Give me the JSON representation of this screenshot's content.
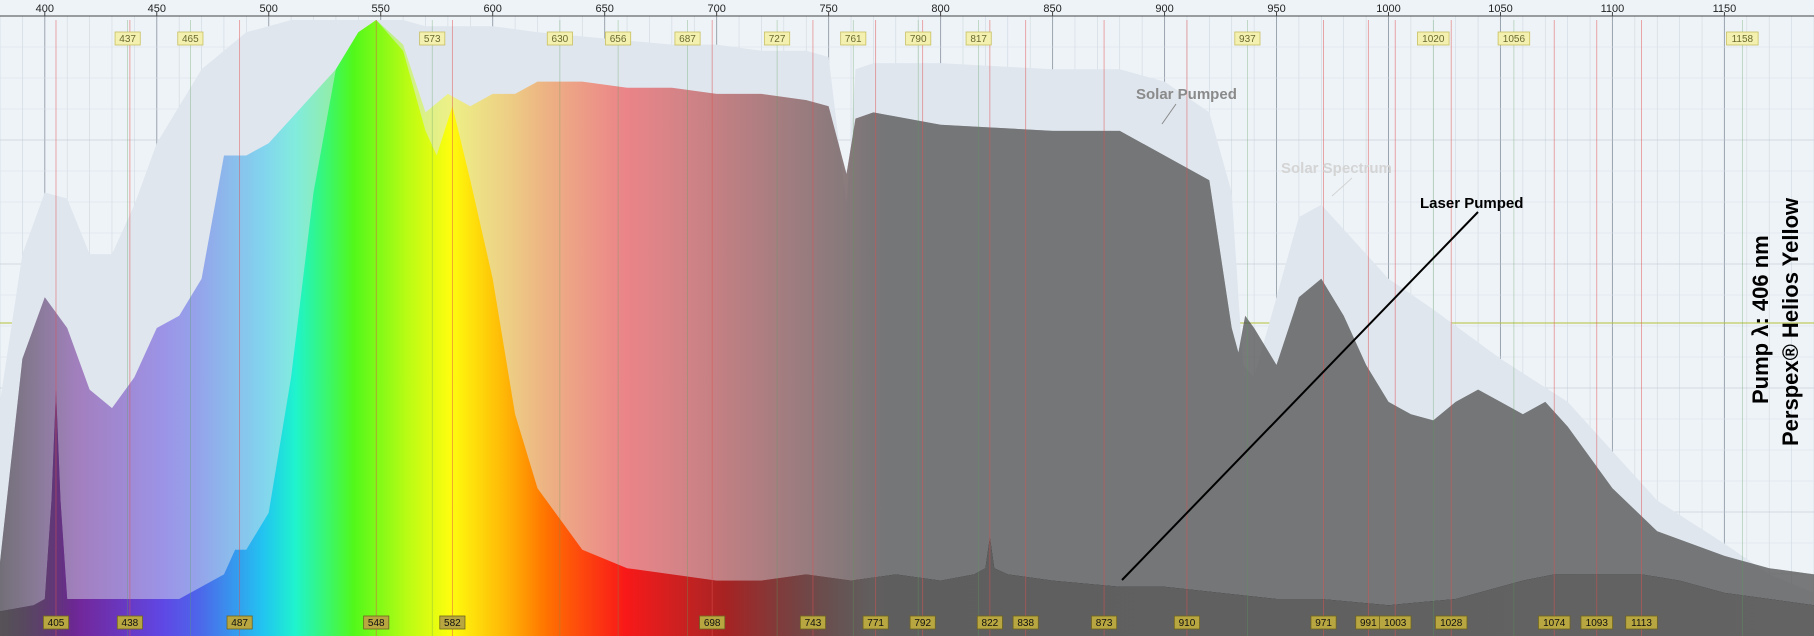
{
  "chart_data": {
    "type": "area",
    "xlim": [
      380,
      1190
    ],
    "x_ticks": [
      "400",
      "450",
      "500",
      "550",
      "600",
      "650",
      "700",
      "750",
      "800",
      "850",
      "900",
      "950",
      "1000",
      "1050",
      "1100",
      "1150"
    ],
    "top_peak_labels": [
      "437",
      "465",
      "573",
      "630",
      "656",
      "687",
      "727",
      "761",
      "790",
      "817",
      "937",
      "1020",
      "1056",
      "1158"
    ],
    "bottom_peak_labels": [
      "405",
      "438",
      "487",
      "548",
      "582",
      "698",
      "743",
      "771",
      "792",
      "822",
      "838",
      "873",
      "910",
      "971",
      "991",
      "1003",
      "1028",
      "1074",
      "1093",
      "1113"
    ],
    "annotations": {
      "solar_pumped": "Solar Pumped",
      "solar_spectrum": "Solar Spectrum",
      "laser_pumped": "Laser Pumped",
      "material": "Perspex® Helios Yellow",
      "pump": "Pump λ: 406 nm"
    },
    "series": [
      {
        "name": "Solar Spectrum",
        "x": [
          380,
          390,
          400,
          410,
          420,
          430,
          440,
          450,
          460,
          470,
          480,
          490,
          500,
          510,
          520,
          530,
          540,
          550,
          560,
          570,
          580,
          590,
          600,
          620,
          650,
          680,
          700,
          720,
          740,
          750,
          758,
          762,
          770,
          800,
          850,
          880,
          900,
          920,
          930,
          935,
          940,
          950,
          960,
          970,
          980,
          1000,
          1020,
          1050,
          1080,
          1100,
          1120,
          1150,
          1170,
          1190
        ],
        "y": [
          0.38,
          0.62,
          0.72,
          0.71,
          0.62,
          0.62,
          0.7,
          0.8,
          0.86,
          0.92,
          0.95,
          0.98,
          0.99,
          1.0,
          1.0,
          1.0,
          1.0,
          1.0,
          1.0,
          0.99,
          0.99,
          0.99,
          0.99,
          0.98,
          0.97,
          0.96,
          0.96,
          0.95,
          0.95,
          0.94,
          0.7,
          0.92,
          0.93,
          0.93,
          0.92,
          0.92,
          0.9,
          0.85,
          0.72,
          0.44,
          0.42,
          0.55,
          0.68,
          0.7,
          0.66,
          0.58,
          0.53,
          0.45,
          0.38,
          0.3,
          0.22,
          0.15,
          0.1,
          0.07
        ]
      },
      {
        "name": "Solar Pumped",
        "x": [
          380,
          390,
          400,
          410,
          420,
          430,
          440,
          450,
          460,
          470,
          480,
          490,
          500,
          510,
          520,
          530,
          540,
          548,
          560,
          570,
          580,
          590,
          600,
          610,
          620,
          640,
          660,
          680,
          700,
          720,
          740,
          750,
          758,
          762,
          770,
          800,
          850,
          880,
          900,
          920,
          930,
          933,
          936,
          940,
          950,
          960,
          970,
          980,
          990,
          1000,
          1010,
          1020,
          1030,
          1040,
          1050,
          1060,
          1070,
          1080,
          1100,
          1120,
          1150,
          1170,
          1190
        ],
        "y": [
          0.12,
          0.45,
          0.55,
          0.5,
          0.4,
          0.37,
          0.42,
          0.5,
          0.52,
          0.58,
          0.78,
          0.78,
          0.8,
          0.84,
          0.88,
          0.92,
          0.96,
          1.0,
          0.96,
          0.85,
          0.88,
          0.86,
          0.88,
          0.88,
          0.9,
          0.9,
          0.89,
          0.89,
          0.88,
          0.88,
          0.87,
          0.86,
          0.75,
          0.84,
          0.85,
          0.83,
          0.82,
          0.82,
          0.78,
          0.74,
          0.5,
          0.46,
          0.52,
          0.5,
          0.44,
          0.55,
          0.58,
          0.52,
          0.44,
          0.38,
          0.36,
          0.35,
          0.38,
          0.4,
          0.38,
          0.36,
          0.38,
          0.34,
          0.24,
          0.17,
          0.13,
          0.11,
          0.1
        ]
      },
      {
        "name": "Laser Pumped",
        "x": [
          380,
          395,
          400,
          403,
          405,
          407,
          410,
          420,
          440,
          460,
          480,
          485,
          490,
          500,
          510,
          520,
          530,
          540,
          548,
          560,
          570,
          575,
          582,
          590,
          600,
          610,
          620,
          640,
          660,
          680,
          700,
          720,
          740,
          760,
          780,
          800,
          815,
          820,
          822,
          824,
          830,
          850,
          880,
          900,
          950,
          970,
          1000,
          1030,
          1060,
          1074,
          1093,
          1113,
          1130,
          1150,
          1170,
          1190
        ],
        "y": [
          0.04,
          0.05,
          0.06,
          0.22,
          0.4,
          0.22,
          0.06,
          0.06,
          0.06,
          0.06,
          0.1,
          0.14,
          0.14,
          0.2,
          0.42,
          0.72,
          0.92,
          0.98,
          1.0,
          0.95,
          0.82,
          0.78,
          0.86,
          0.74,
          0.58,
          0.36,
          0.24,
          0.14,
          0.11,
          0.1,
          0.09,
          0.09,
          0.1,
          0.09,
          0.1,
          0.09,
          0.1,
          0.11,
          0.16,
          0.11,
          0.1,
          0.09,
          0.08,
          0.08,
          0.06,
          0.06,
          0.05,
          0.06,
          0.09,
          0.1,
          0.1,
          0.1,
          0.09,
          0.07,
          0.06,
          0.05
        ]
      }
    ]
  }
}
